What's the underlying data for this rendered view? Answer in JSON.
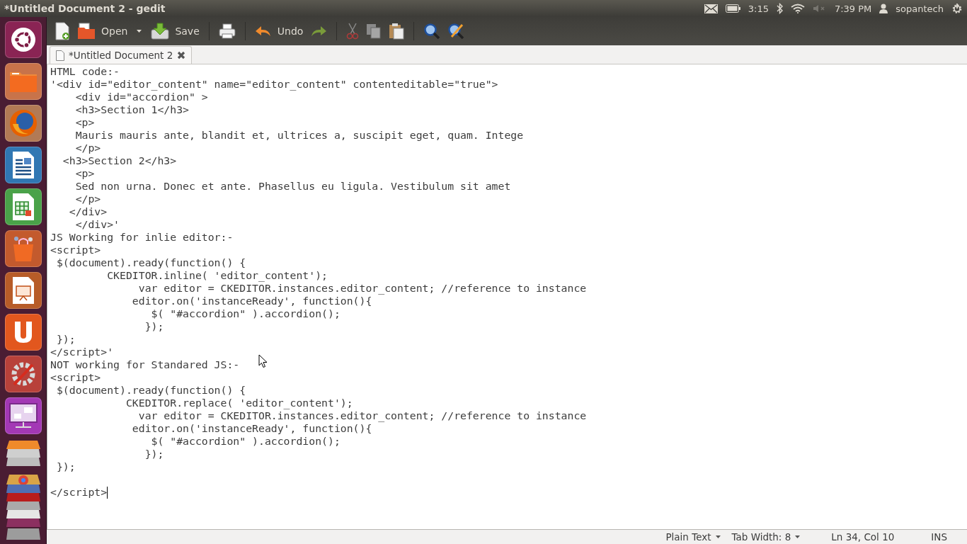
{
  "window": {
    "title": "*Untitled Document 2 - gedit"
  },
  "top_panel": {
    "battery_time": "3:15",
    "clock": "7:39 PM",
    "user": "sopantech"
  },
  "toolbar": {
    "open_label": "Open",
    "save_label": "Save",
    "undo_label": "Undo"
  },
  "document_tab": {
    "label": "*Untitled Document 2"
  },
  "editor": {
    "blocks": [
      {
        "lines": [
          "HTML code:-",
          "'<div id=\"editor_content\" name=\"editor_content\" contenteditable=\"true\">",
          "    <div id=\"accordion\" >",
          "    <h3>Section 1</h3>",
          "    <p>",
          "    Mauris mauris ante, blandit et, ultrices a, suscipit eget, quam. Intege",
          "    </p>",
          "  <h3>Section 2</h3>",
          "    <p>",
          "    Sed non urna. Donec et ante. Phasellus eu ligula. Vestibulum sit amet",
          "    </p>",
          "   </div>",
          "    </div>'",
          "JS Working for inlie editor:-",
          "<script>",
          " $(document).ready(function() {",
          "         CKEDITOR.inline( 'editor_content');",
          "              var editor = CKEDITOR.instances.editor_content; //reference to instance",
          "             editor.on('instanceReady', function(){",
          "                $( \"#accordion\" ).accordion();",
          "               });",
          " });",
          "</script>'",
          "NOT working for Standared JS:-",
          "<script>",
          " $(document).ready(function() {",
          "            CKEDITOR.replace( 'editor_content');",
          "              var editor = CKEDITOR.instances.editor_content; //reference to instance",
          "             editor.on('instanceReady', function(){",
          "                $( \"#accordion\" ).accordion();",
          "               });",
          " });"
        ]
      },
      {
        "lines": [
          "</script>"
        ]
      }
    ]
  },
  "status_bar": {
    "language": "Plain Text",
    "tab_width": "Tab Width: 8",
    "position": "Ln 34, Col 10",
    "mode": "INS"
  }
}
